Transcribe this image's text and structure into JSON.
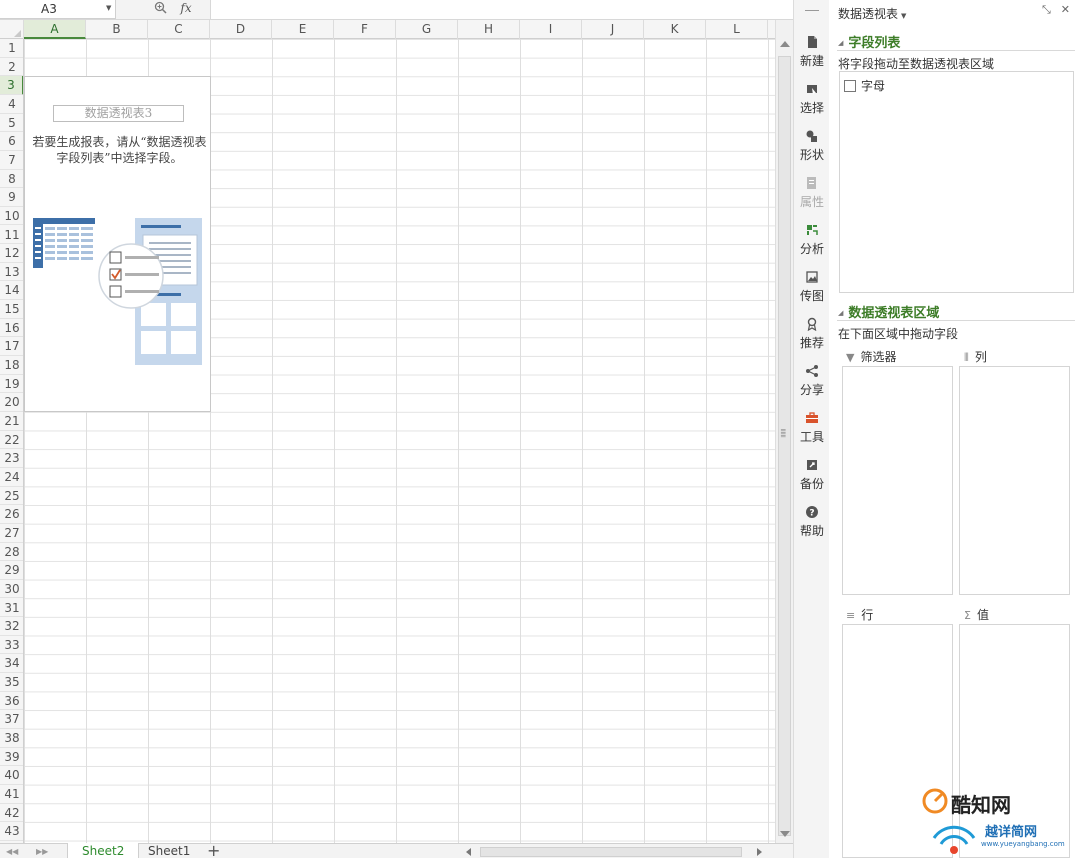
{
  "formula_bar": {
    "name_box": "A3",
    "fx_label": "fx",
    "zoom_icon": "magnifier-icon",
    "formula_value": ""
  },
  "grid": {
    "columns": [
      "A",
      "B",
      "C",
      "D",
      "E",
      "F",
      "G",
      "H",
      "I",
      "J",
      "K",
      "L"
    ],
    "rows": [
      "1",
      "2",
      "3",
      "4",
      "5",
      "6",
      "7",
      "8",
      "9",
      "10",
      "11",
      "12",
      "13",
      "14",
      "15",
      "16",
      "17",
      "18",
      "19",
      "20",
      "21",
      "22",
      "23",
      "24",
      "25",
      "26",
      "27",
      "28",
      "29",
      "30",
      "31",
      "32",
      "33",
      "34",
      "35",
      "36",
      "37",
      "38",
      "39",
      "40",
      "41",
      "42",
      "43"
    ],
    "active_cell": "A3",
    "active_column": "A",
    "active_row": "3"
  },
  "pivot_placeholder": {
    "name": "数据透视表3",
    "hint": "若要生成报表，请从“数据透视表字段列表”中选择字段。",
    "illustration_icon": "pivot-table-illustration"
  },
  "sheet_bar": {
    "tabs": [
      {
        "label": "Sheet2",
        "active": true
      },
      {
        "label": "Sheet1",
        "active": false
      }
    ],
    "add_label": "+"
  },
  "side_toolbar": {
    "items": [
      {
        "label": "新建",
        "icon": "new-file-icon",
        "enabled": true
      },
      {
        "label": "选择",
        "icon": "select-icon",
        "enabled": true
      },
      {
        "label": "形状",
        "icon": "shapes-icon",
        "enabled": true
      },
      {
        "label": "属性",
        "icon": "properties-icon",
        "enabled": false
      },
      {
        "label": "分析",
        "icon": "analysis-icon",
        "enabled": true
      },
      {
        "label": "传图",
        "icon": "send-image-icon",
        "enabled": true
      },
      {
        "label": "推荐",
        "icon": "recommend-icon",
        "enabled": true
      },
      {
        "label": "分享",
        "icon": "share-icon",
        "enabled": true
      },
      {
        "label": "工具",
        "icon": "toolbox-icon",
        "enabled": true
      },
      {
        "label": "备份",
        "icon": "backup-icon",
        "enabled": true
      },
      {
        "label": "帮助",
        "icon": "help-icon",
        "enabled": true
      }
    ]
  },
  "panel": {
    "title": "数据透视表",
    "field_list": {
      "heading": "字段列表",
      "instruction": "将字段拖动至数据透视表区域",
      "fields": [
        {
          "label": "字母",
          "checked": false
        }
      ]
    },
    "areas_section": {
      "heading": "数据透视表区域",
      "instruction": "在下面区域中拖动字段",
      "areas": {
        "filter": {
          "label": "筛选器",
          "icon": "filter-icon"
        },
        "columns": {
          "label": "列",
          "icon": "columns-icon"
        },
        "rows": {
          "label": "行",
          "icon": "rows-icon"
        },
        "values": {
          "label": "值",
          "icon": "sigma-icon"
        }
      }
    }
  },
  "watermarks": {
    "brand1": "酷知网",
    "brand2": "越详简网",
    "brand2_url": "www.yueyangbang.com"
  },
  "colors": {
    "accent_green": "#48893c",
    "heading_green": "#3d7d28",
    "active_tab_text": "#2e8b2e"
  }
}
